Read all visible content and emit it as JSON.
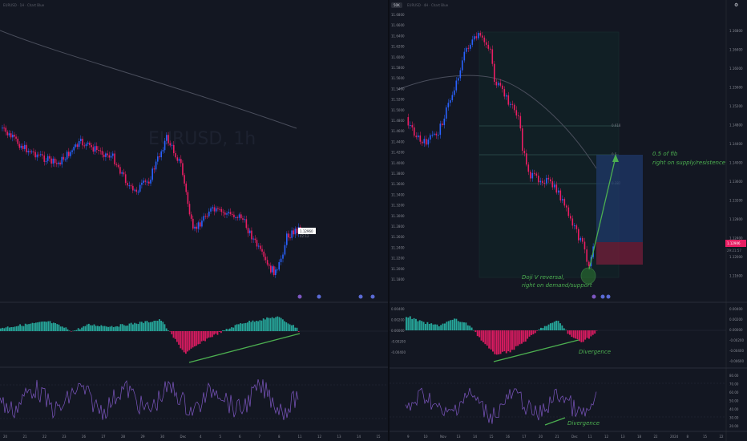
{
  "colors": {
    "background": "#131722",
    "up": "#2962ff",
    "down": "#e91e63",
    "macd_up": "#26a69a",
    "macd_down": "#d81b60",
    "annotation": "#4caf50",
    "rsi": "#7e57c2"
  },
  "left": {
    "title": "EURUSD · 1H · Chart Blue",
    "watermark": "EURUSD, 1h",
    "price_tag": "1.12960",
    "price_tag_sub": "42:12",
    "x_ticks": [
      "20",
      "21",
      "22",
      "23",
      "26",
      "27",
      "28",
      "29",
      "30",
      "Dec",
      "4",
      "5",
      "6",
      "7",
      "8",
      "11",
      "12",
      "13",
      "14",
      "15"
    ],
    "icons": [
      "alert-icon",
      "flag-icon",
      "calendar-icon",
      "calendar-icon"
    ]
  },
  "right": {
    "symbol_button": "50K",
    "title": "EURUSD · 4H · Chart Blue",
    "price_tag": "1.12906",
    "price_tag_sub": "29:21:57",
    "y_ticks": [
      "1.16800",
      "1.16400",
      "1.16000",
      "1.15600",
      "1.15200",
      "1.14800",
      "1.14400",
      "1.14000",
      "1.13600",
      "1.13200",
      "1.12800",
      "1.12400",
      "1.12000",
      "1.11600"
    ],
    "y_ticks_left": [
      "11.6800",
      "11.6600",
      "11.6400",
      "11.6200",
      "11.6000",
      "11.5800",
      "11.5600",
      "11.5400",
      "11.5200",
      "11.5000",
      "11.4800",
      "11.4600",
      "11.4400",
      "11.4200",
      "11.4000",
      "11.3800",
      "11.3600",
      "11.3400",
      "11.3200",
      "11.3000",
      "11.2800",
      "11.2600",
      "11.2400",
      "11.2200",
      "11.2000",
      "11.1800"
    ],
    "macd_ticks": [
      "0.00400",
      "0.00200",
      "0.00000",
      "-0.00200",
      "-0.00400",
      "-0.00600"
    ],
    "macd_ticks_left": [
      "0.00400",
      "0.00200",
      "0.00000",
      "-0.00200",
      "-0.00400"
    ],
    "rsi_ticks": [
      "80.00",
      "70.00",
      "60.00",
      "50.00",
      "40.00",
      "30.00",
      "20.00"
    ],
    "x_ticks": [
      "9",
      "10",
      "Nov",
      "13",
      "14",
      "15",
      "16",
      "17",
      "20",
      "21",
      "Dec",
      "11",
      "12",
      "13",
      "18",
      "22",
      "2024",
      "8",
      "15",
      "22"
    ],
    "fib_labels": [
      "0.618",
      "0.5",
      "0.382"
    ],
    "annotations": {
      "fib_line1": "0.5 of fib",
      "fib_line2": "right on supply/resistence",
      "doji_line1": "Doji V reversal,",
      "doji_line2": "right on demand/support",
      "macd_divergence": "Divergence",
      "rsi_divergence": "Divergence"
    }
  }
}
